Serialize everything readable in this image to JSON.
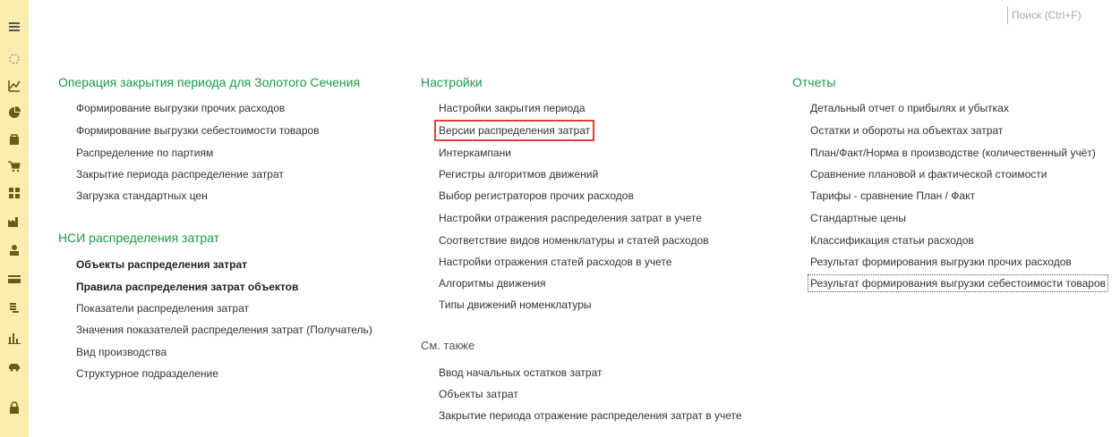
{
  "search": {
    "placeholder": "Поиск (Ctrl+F)"
  },
  "sidebar": {
    "items": [
      "menu-icon",
      "history-icon",
      "chart-icon",
      "pie-icon",
      "bag-icon",
      "cart-icon",
      "grid-icon",
      "factory-icon",
      "person-icon",
      "card-icon",
      "coins-icon",
      "bar-chart-icon",
      "car-icon",
      "lock-icon"
    ],
    "accent": "#fbedae"
  },
  "col1": {
    "section1": {
      "title": "Операция закрытия периода для Золотого Сечения",
      "items": [
        "Формирование выгрузки прочих расходов",
        "Формирование выгрузки себестоимости товаров",
        "Распределение по партиям",
        "Закрытие периода распределение затрат",
        "Загрузка стандартных цен"
      ]
    },
    "section2": {
      "title": "НСИ распределения затрат",
      "items": [
        "Объекты распределения затрат",
        "Правила распределения затрат объектов",
        "Показатели распределения затрат",
        "Значения показателей распределения затрат (Получатель)",
        "Вид производства",
        "Структурное подразделение"
      ]
    }
  },
  "col2": {
    "section1": {
      "title": "Настройки",
      "items": [
        "Настройки закрытия периода",
        "Версии распределения затрат",
        "Интеркампани",
        "Регистры алгоритмов движений",
        "Выбор регистраторов прочих расходов",
        "Настройки отражения распределения затрат в учете",
        "Соответствие видов номенклатуры и статей расходов",
        "Настройки отражения статей расходов в учете",
        "Алгоритмы движения",
        "Типы движений номенклатуры"
      ]
    },
    "section2": {
      "title": "См. также",
      "items": [
        "Ввод начальных остатков затрат",
        "Объекты затрат",
        "Закрытие периода отражение распределения затрат в учете"
      ]
    }
  },
  "col3": {
    "section1": {
      "title": "Отчеты",
      "items": [
        "Детальный отчет о прибылях и убытках",
        "Остатки и обороты на объектах затрат",
        "План/Факт/Норма в производстве (количественный учёт)",
        "Сравнение плановой и фактической стоимости",
        "Тарифы - сравнение План / Факт",
        "Стандартные цены",
        "Классификация статьи расходов",
        "Результат формирования выгрузки прочих расходов",
        "Результат формирования выгрузки себестоимости товаров"
      ]
    }
  },
  "colors": {
    "section_title": "#1a9a4a",
    "highlight_border": "#e0403c",
    "text": "#333333"
  }
}
